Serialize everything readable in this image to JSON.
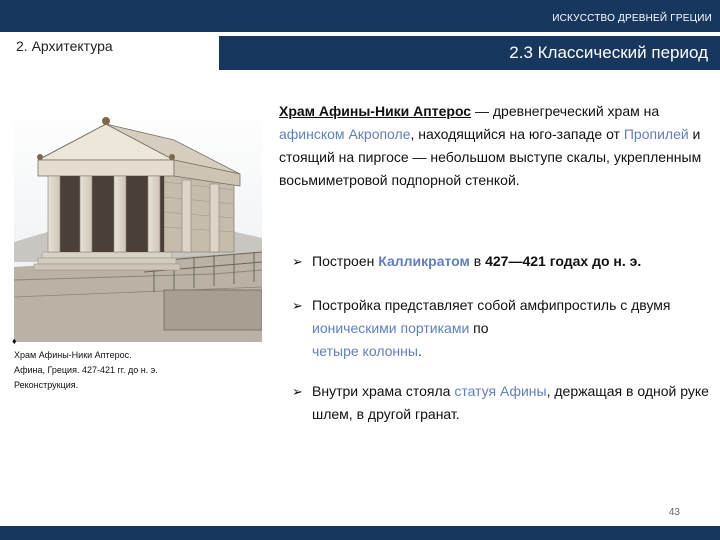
{
  "header": {
    "label": "ИСКУССТВО ДРЕВНЕЙ ГРЕЦИИ"
  },
  "section": {
    "label": "2. Архитектура"
  },
  "subtitle": {
    "text": "2.3 Классический период"
  },
  "intro": {
    "title": "Храм Афины-Ники Аптерос",
    "dash": " — древнегреческий храм на ",
    "link_acropolis": "афинском Акрополе",
    "text2": ", находящийся на юго-западе от ",
    "link_propylaea": "Пропилей",
    "text3": " и стоящий на пиргосе — небольшом выступе скалы, укрепленным восьмиметровой подпорной стенкой."
  },
  "bullets": {
    "b1": {
      "prefix": "Построен ",
      "name": "Калликратом",
      "mid": " в ",
      "years": "427—421 годах до н. э."
    },
    "b2": {
      "prefix": "Постройка представляет собой амфипростиль с двумя ",
      "link": "ионическими портиками",
      "mid": " по ",
      "link2": "четыре колонны",
      "suffix": "."
    },
    "b3": {
      "prefix": "Внутри храма стояла ",
      "link": "статуя Афины",
      "suffix": ", держащая в одной руке шлем, в другой гранат."
    }
  },
  "caption": {
    "line1": "Храм Афины-Ники Аптерос.",
    "line2": "Афина, Греция. 427-421 гг. до н. э.",
    "line3": "Реконструкция."
  },
  "page": {
    "number": "43"
  },
  "colors": {
    "brand": "#17375e",
    "link": "#5f7fbf"
  },
  "icons": {
    "bullet": "arrow-bullet-icon"
  }
}
